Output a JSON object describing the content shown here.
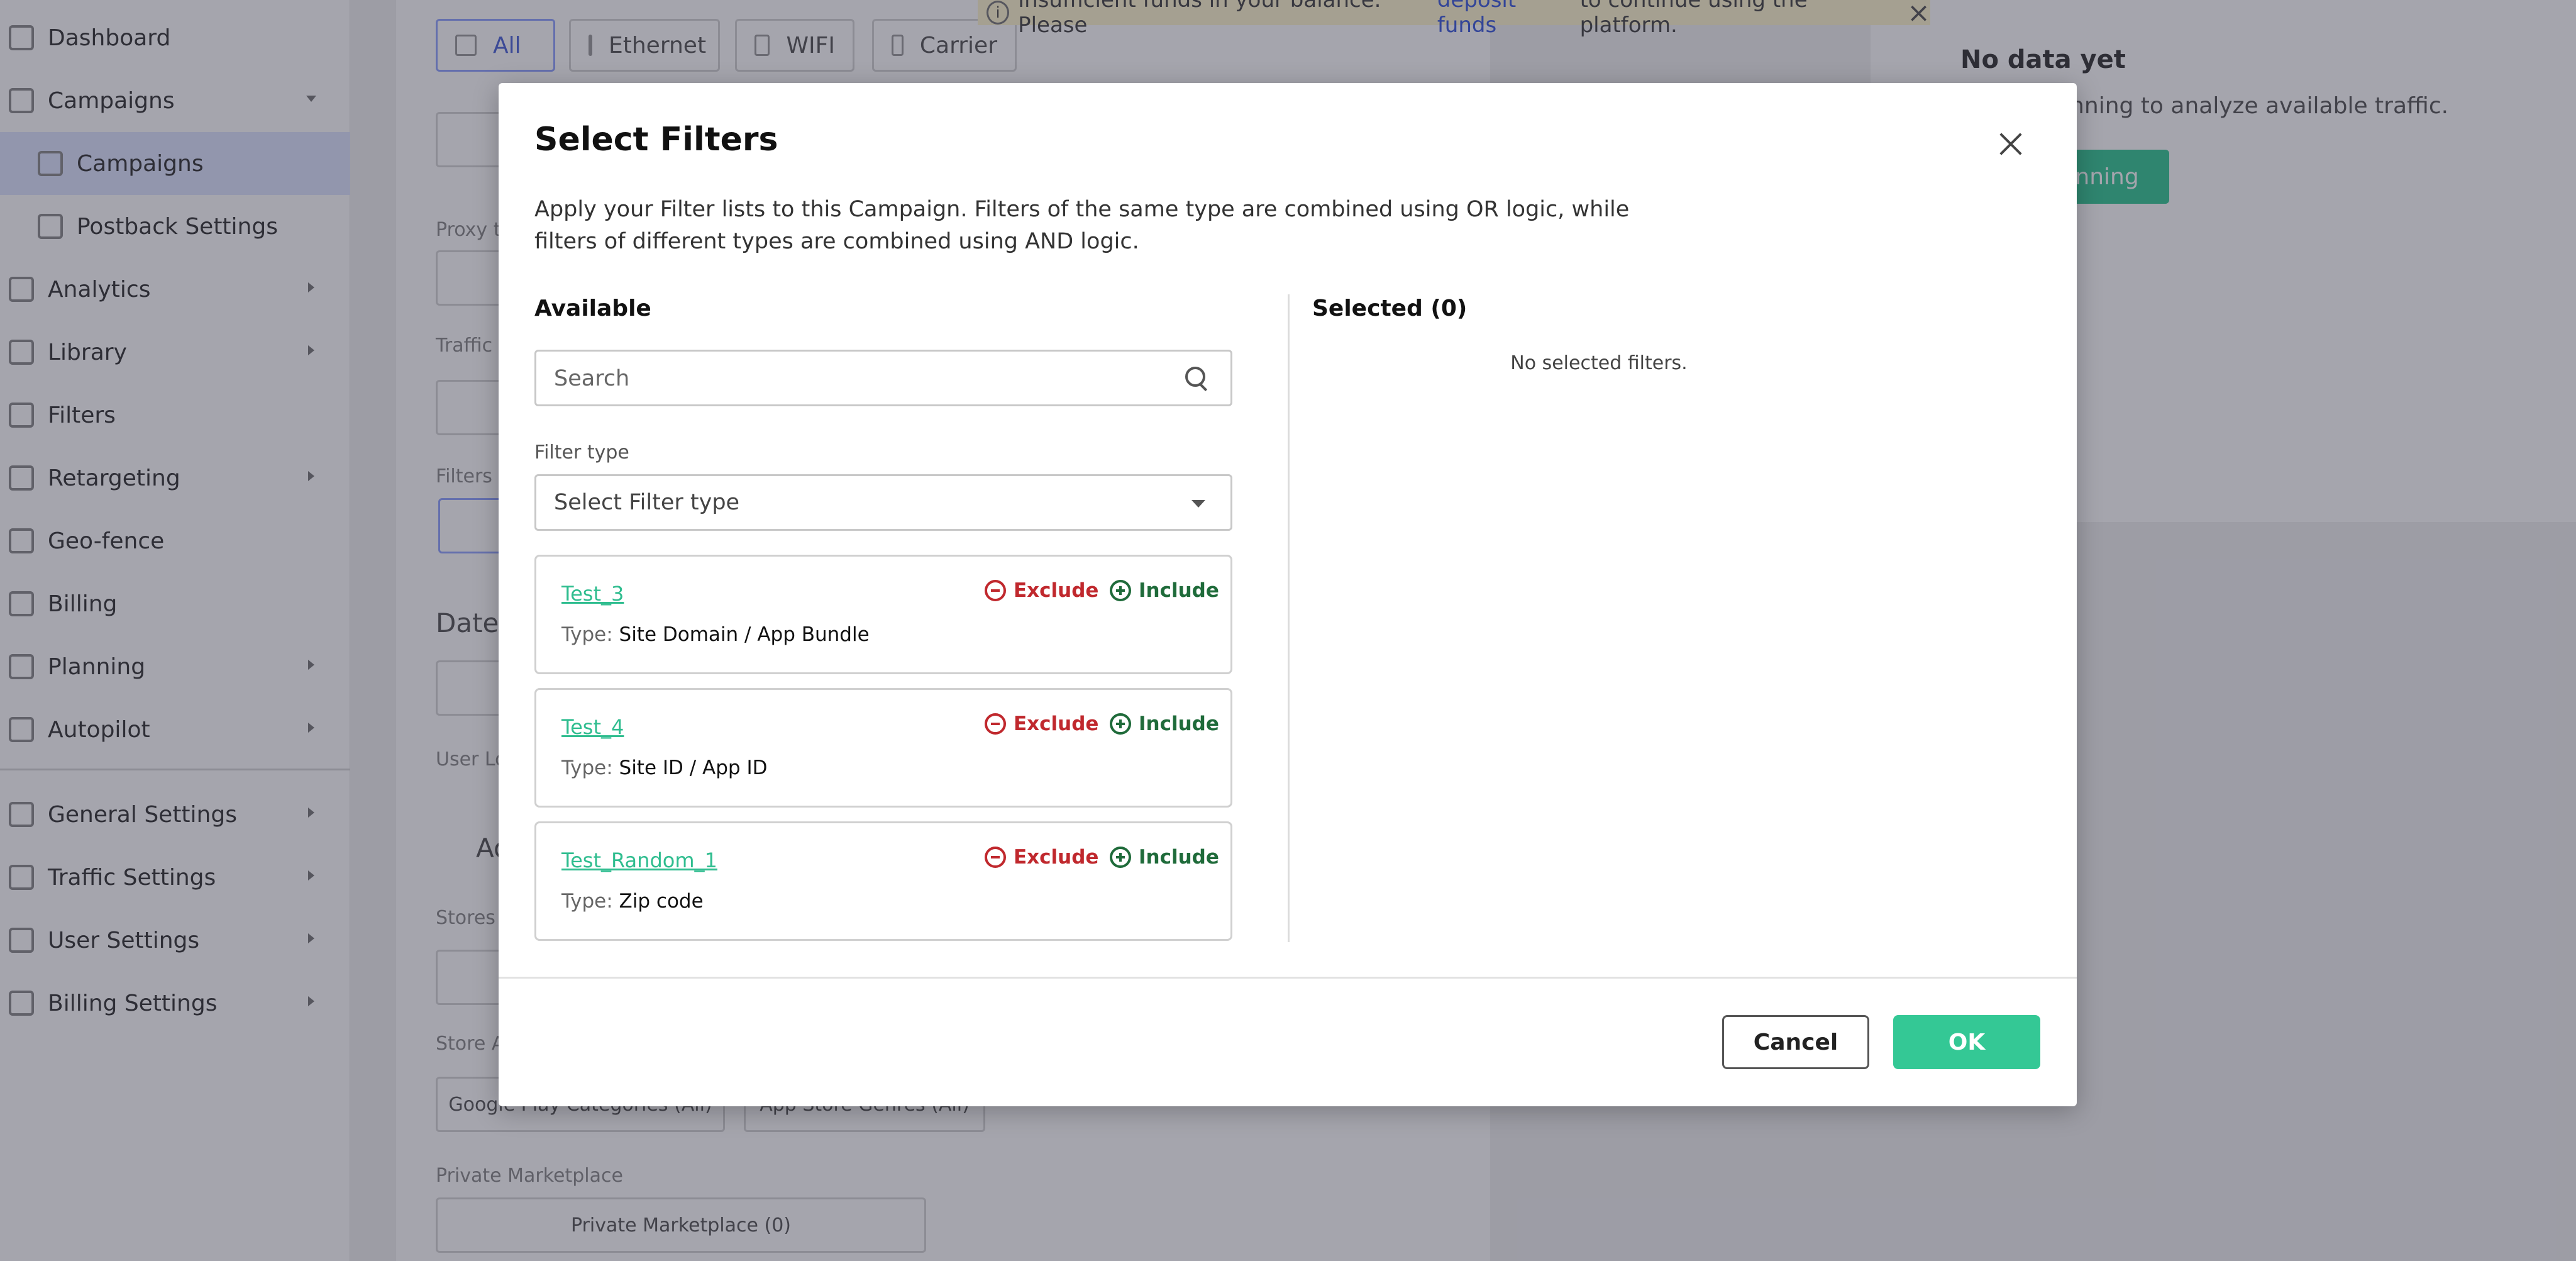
{
  "sidebar": {
    "items": [
      {
        "label": "Dashboard",
        "icon": "grid-icon"
      },
      {
        "label": "Campaigns",
        "icon": "megaphone-icon"
      },
      {
        "label": "Campaigns",
        "icon": "megaphone-icon"
      },
      {
        "label": "Postback Settings",
        "icon": "link-icon"
      },
      {
        "label": "Analytics",
        "icon": "analytics-icon"
      },
      {
        "label": "Library",
        "icon": "image-icon"
      },
      {
        "label": "Filters",
        "icon": "funnel-icon"
      },
      {
        "label": "Retargeting",
        "icon": "refresh-icon"
      },
      {
        "label": "Geo-fence",
        "icon": "pin-icon"
      },
      {
        "label": "Billing",
        "icon": "card-icon"
      },
      {
        "label": "Planning",
        "icon": "calendar-icon"
      },
      {
        "label": "Autopilot",
        "icon": "play-icon"
      },
      {
        "label": "General Settings",
        "icon": "gear-icon"
      },
      {
        "label": "Traffic Settings",
        "icon": "traffic-icon"
      },
      {
        "label": "User Settings",
        "icon": "user-icon"
      },
      {
        "label": "Billing Settings",
        "icon": "wallet-icon"
      }
    ]
  },
  "background": {
    "connection_types": [
      "All",
      "Ethernet",
      "WIFI",
      "Carrier"
    ],
    "labels": {
      "proxy": "Proxy t",
      "traffic": "Traffic",
      "filters": "Filters",
      "date": "Date",
      "user_local": "User Lo",
      "advanced": "Ad",
      "stores": "Stores",
      "store_a": "Store A",
      "private_marketplace": "Private Marketplace"
    },
    "buttons": {
      "google_play": "Google Play Categories (All)",
      "app_store": "App Store Genres (All)",
      "private_marketplace": "Private Marketplace (0)"
    },
    "banner": {
      "text_before": "Insufficient funds in your balance. Please",
      "link": "deposit funds",
      "text_after": "to continue using the platform."
    },
    "no_data": {
      "title": "No data yet",
      "text": "anning to analyze available traffic.",
      "button": "anning"
    }
  },
  "modal": {
    "title": "Select Filters",
    "description": "Apply your Filter lists to this Campaign. Filters of the same type are combined using OR logic, while filters of different types are combined using AND logic.",
    "available_title": "Available",
    "search_placeholder": "Search",
    "filter_type_label": "Filter type",
    "filter_type_placeholder": "Select Filter type",
    "type_key": "Type:",
    "exclude_label": "Exclude",
    "include_label": "Include",
    "filters": [
      {
        "name": "Test_3",
        "type": "Site Domain / App Bundle"
      },
      {
        "name": "Test_4",
        "type": "Site ID / App ID"
      },
      {
        "name": "Test_Random_1",
        "type": "Zip code"
      }
    ],
    "selected_title": "Selected (0)",
    "no_selected": "No selected filters.",
    "cancel": "Cancel",
    "ok": "OK"
  },
  "colors": {
    "accent": "#34c895",
    "exclude": "#c0282d",
    "include": "#1f6b3a",
    "link": "#2fbd8f"
  }
}
